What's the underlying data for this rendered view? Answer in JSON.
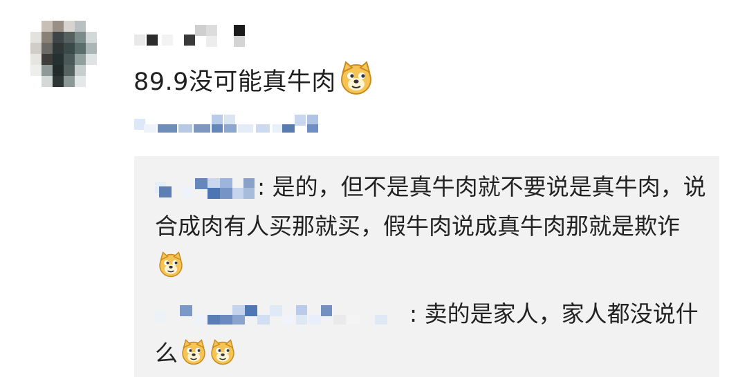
{
  "comment": {
    "text": "89.9没可能真牛肉",
    "emoji": "doge-icon"
  },
  "replies": [
    {
      "text": ": 是的，但不是真牛肉就不要说是真牛肉，说合成肉有人买那就买，假牛肉说成真牛肉那就是欺诈",
      "emoji": "doge-icon"
    },
    {
      "text": ": 卖的是家人，家人都没说什么",
      "emojis": [
        "doge-icon",
        "doge-icon"
      ]
    }
  ],
  "colors": {
    "reply_bg": "#f2f2f2",
    "text": "#222222",
    "blur_blue": "#4f79b8",
    "blur_light": "#cfdff2"
  }
}
